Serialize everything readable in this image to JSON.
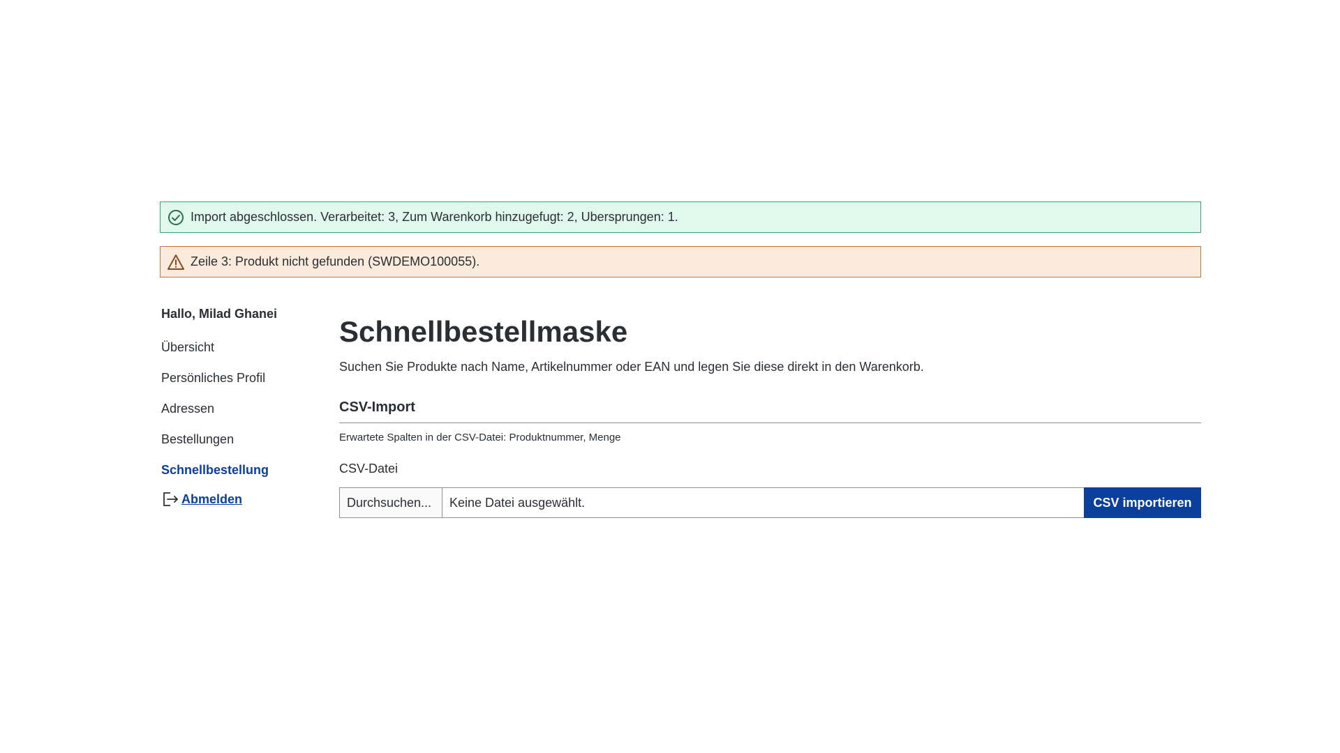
{
  "alerts": {
    "success": {
      "icon": "check-circle-icon",
      "text": "Import abgeschlossen. Verarbeitet: 3, Zum Warenkorb hinzugefugt: 2, Ubersprungen: 1.",
      "color": "#37a376",
      "background": "#e0f8ee"
    },
    "warning": {
      "icon": "warning-triangle-icon",
      "text": "Zeile 3: Produkt nicht gefunden (SWDEMO100055).",
      "color": "#c8763f",
      "background": "#fbebdd"
    }
  },
  "sidebar": {
    "greeting": "Hallo, Milad Ghanei",
    "items": [
      {
        "label": "Übersicht",
        "active": false
      },
      {
        "label": "Persönliches Profil",
        "active": false
      },
      {
        "label": "Adressen",
        "active": false
      },
      {
        "label": "Bestellungen",
        "active": false
      },
      {
        "label": "Schnellbestellung",
        "active": true
      }
    ],
    "logout": {
      "icon": "logout-icon",
      "label": "Abmelden"
    }
  },
  "main": {
    "title": "Schnellbestellmaske",
    "description": "Suchen Sie Produkte nach Name, Artikelnummer oder EAN und legen Sie diese direkt in den Warenkorb.",
    "csv_section": {
      "title": "CSV-Import",
      "hint": "Erwartete Spalten in der CSV-Datei: Produktnummer, Menge",
      "field_label": "CSV-Datei",
      "browse_label": "Durchsuchen...",
      "file_status": "Keine Datei ausgewählt.",
      "import_button": "CSV importieren"
    }
  },
  "colors": {
    "accent": "#0b3f9c",
    "text": "#2b2f33"
  }
}
